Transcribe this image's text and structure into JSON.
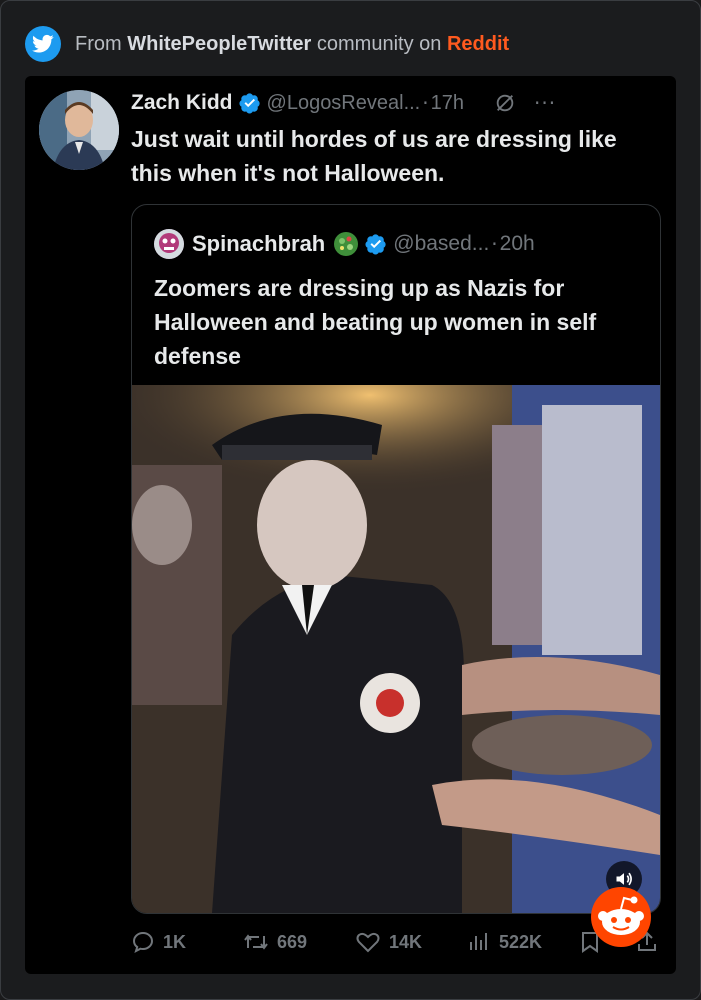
{
  "source": {
    "prefix": "From",
    "community": "WhitePeopleTwitter",
    "middle": "community on",
    "platform": "Reddit"
  },
  "tweet": {
    "name": "Zach Kidd",
    "handle": "@LogosReveal...",
    "separator": "·",
    "time": "17h",
    "more": "···",
    "text": "Just wait until hordes of us are dressing like this when it's not Halloween."
  },
  "quote": {
    "name": "Spinachbrah",
    "handle": "@based...",
    "separator": "·",
    "time": "20h",
    "text": "Zoomers are dressing up as Nazis for Halloween and beating up women in self defense"
  },
  "actions": {
    "replies": "1K",
    "reposts": "669",
    "likes": "14K",
    "views": "522K"
  },
  "colors": {
    "accent": "#1d9bf0",
    "reddit": "#ff4500",
    "muted": "#71767b"
  },
  "icons": [
    "twitter-bird-icon",
    "verified-badge-icon",
    "grok-icon",
    "more-icon",
    "reply-icon",
    "repost-icon",
    "like-icon",
    "views-icon",
    "bookmark-icon",
    "share-icon",
    "volume-icon",
    "reddit-logo-icon"
  ]
}
